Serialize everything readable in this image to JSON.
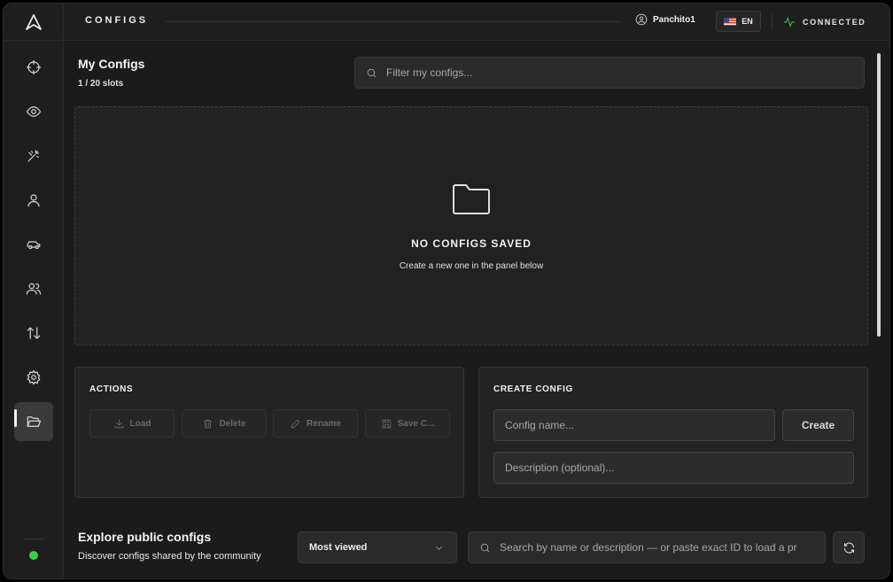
{
  "header": {
    "title": "CONFIGS",
    "user_name": "Panchito1",
    "language": "EN",
    "connection_status": "CONNECTED",
    "status_color": "#3ecf4a"
  },
  "sidebar": {
    "items": [
      {
        "icon": "crosshair-icon",
        "label": "aim"
      },
      {
        "icon": "eye-icon",
        "label": "visuals"
      },
      {
        "icon": "wand-icon",
        "label": "misc"
      },
      {
        "icon": "user-icon",
        "label": "player"
      },
      {
        "icon": "car-icon",
        "label": "vehicle"
      },
      {
        "icon": "users-icon",
        "label": "players"
      },
      {
        "icon": "arrows-updown-icon",
        "label": "transfer"
      },
      {
        "icon": "gear-icon",
        "label": "settings"
      },
      {
        "icon": "folder-open-icon",
        "label": "configs",
        "active": true
      }
    ]
  },
  "main": {
    "title": "My Configs",
    "slots": "1 / 20 slots",
    "filter_placeholder": "Filter my configs...",
    "empty": {
      "title": "NO CONFIGS SAVED",
      "subtitle": "Create a new one in the panel below"
    },
    "actions": {
      "title": "ACTIONS",
      "load": "Load",
      "delete": "Delete",
      "rename": "Rename",
      "save": "Save C..."
    },
    "create": {
      "title": "CREATE CONFIG",
      "name_placeholder": "Config name...",
      "create_label": "Create",
      "description_placeholder": "Description (optional)..."
    },
    "explore": {
      "title": "Explore public configs",
      "subtitle": "Discover configs shared by the community",
      "sort_value": "Most viewed",
      "search_placeholder": "Search by name or description — or paste exact ID to load a pr"
    }
  }
}
